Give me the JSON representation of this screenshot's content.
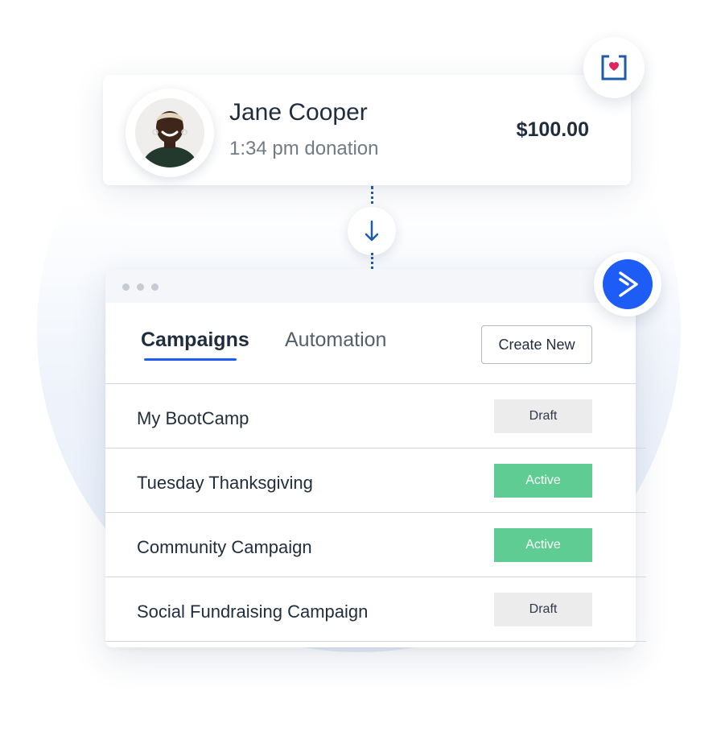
{
  "donation": {
    "name": "Jane Cooper",
    "time": "1:34 pm donation",
    "amount": "$100.00"
  },
  "icons": {
    "brand": "heart-box-icon",
    "connector": "arrow-down-icon",
    "automation_brand": "chevron-right-icon"
  },
  "tabs": [
    {
      "label": "Campaigns",
      "active": true
    },
    {
      "label": "Automation",
      "active": false
    }
  ],
  "create_button": "Create New",
  "campaigns": [
    {
      "name": "My BootCamp",
      "status": "Draft"
    },
    {
      "name": "Tuesday Thanksgiving",
      "status": "Active"
    },
    {
      "name": "Community Campaign",
      "status": "Active"
    },
    {
      "name": "Social Fundraising Campaign",
      "status": "Draft"
    }
  ],
  "colors": {
    "accent": "#1d5cf5",
    "active_status": "#5fcc93",
    "draft_status": "#ececec",
    "heart": "#e0245e",
    "brand_box": "#1f5ba8"
  }
}
